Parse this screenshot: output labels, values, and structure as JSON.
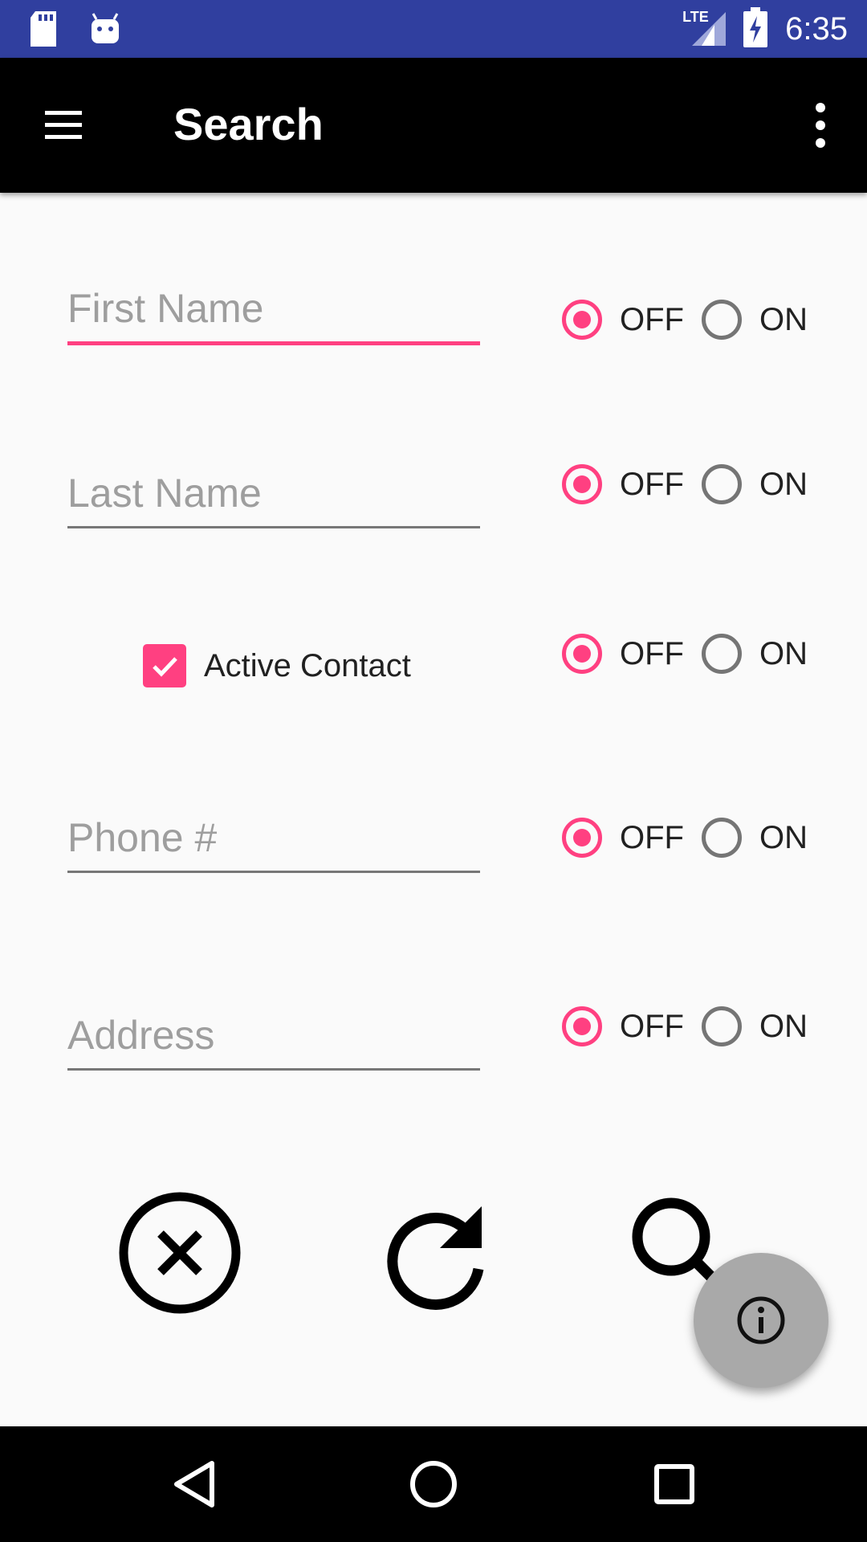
{
  "status_bar": {
    "time": "6:35",
    "network_label": "LTE",
    "icons": [
      "sd-card-icon",
      "android-debug-icon",
      "lte-signal-icon",
      "battery-charging-icon"
    ],
    "color": "#303f9f"
  },
  "app_bar": {
    "title": "Search",
    "menu_icon": "hamburger-menu-icon",
    "overflow_icon": "more-vert-icon"
  },
  "form": {
    "first_name": {
      "placeholder": "First Name",
      "value": "",
      "focused": true,
      "toggle": {
        "off_label": "OFF",
        "on_label": "ON",
        "selected": "OFF"
      }
    },
    "last_name": {
      "placeholder": "Last Name",
      "value": "",
      "toggle": {
        "off_label": "OFF",
        "on_label": "ON",
        "selected": "OFF"
      }
    },
    "active_contact": {
      "label": "Active Contact",
      "checked": true,
      "toggle": {
        "off_label": "OFF",
        "on_label": "ON",
        "selected": "OFF"
      }
    },
    "phone": {
      "placeholder": "Phone #",
      "value": "",
      "toggle": {
        "off_label": "OFF",
        "on_label": "ON",
        "selected": "OFF"
      }
    },
    "address": {
      "placeholder": "Address",
      "value": "",
      "toggle": {
        "off_label": "OFF",
        "on_label": "ON",
        "selected": "OFF"
      }
    }
  },
  "actions": {
    "icons": [
      "clear-icon",
      "refresh-icon",
      "search-icon"
    ],
    "fab_icon": "info-icon"
  },
  "nav_bar": {
    "icons": [
      "back-icon",
      "home-icon",
      "recents-icon"
    ]
  },
  "colors": {
    "accent": "#ff4081",
    "app_bar": "#000000",
    "status_bar": "#303f9f",
    "fab": "#a9a9a9"
  }
}
